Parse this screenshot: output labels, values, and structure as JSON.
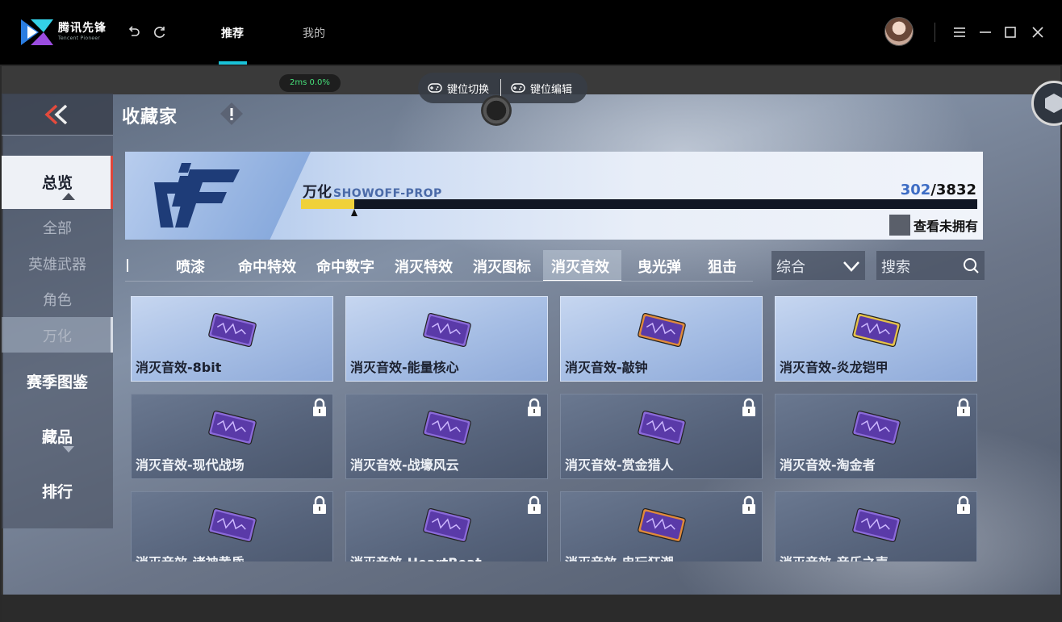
{
  "app": {
    "brand_cn": "腾讯先锋",
    "brand_en": "Tencent Pioneer",
    "tabs": [
      {
        "label": "推荐",
        "active": true
      },
      {
        "label": "我的",
        "active": false
      }
    ],
    "accent": "#19c2d8"
  },
  "overlay": {
    "ping": "2ms  0.0%",
    "key_switch": "键位切换",
    "key_edit": "键位编辑"
  },
  "page": {
    "title": "收藏家",
    "sidebar": [
      {
        "label": "总览",
        "type": "main",
        "active": true
      },
      {
        "label": "全部",
        "type": "sub",
        "active": false
      },
      {
        "label": "英雄武器",
        "type": "sub",
        "active": false
      },
      {
        "label": "角色",
        "type": "sub",
        "active": false
      },
      {
        "label": "万化",
        "type": "sub",
        "active": true
      },
      {
        "label": "赛季图鉴",
        "type": "main",
        "active": false
      },
      {
        "label": "藏品",
        "type": "main",
        "active": false
      },
      {
        "label": "排行",
        "type": "main",
        "active": false
      }
    ]
  },
  "banner": {
    "name": "万化",
    "subtitle": "SHOWOFF-PROP",
    "owned": 302,
    "total": 3832,
    "owned_text": "302",
    "total_text": "/3832",
    "unowned_label": "查看未拥有"
  },
  "categories": {
    "items": [
      "喷漆",
      "命中特效",
      "命中数字",
      "消灭特效",
      "消灭图标",
      "消灭音效",
      "曳光弹",
      "狙击"
    ],
    "active": "消灭音效",
    "sort_label": "综合",
    "search_placeholder": "搜索"
  },
  "items": [
    {
      "name": "消灭音效-8bit",
      "owned": true,
      "rarity": "purple"
    },
    {
      "name": "消灭音效-能量核心",
      "owned": true,
      "rarity": "purple"
    },
    {
      "name": "消灭音效-敲钟",
      "owned": true,
      "rarity": "orange"
    },
    {
      "name": "消灭音效-炎龙铠甲",
      "owned": true,
      "rarity": "gold"
    },
    {
      "name": "消灭音效-现代战场",
      "owned": false,
      "rarity": "purple"
    },
    {
      "name": "消灭音效-战壕风云",
      "owned": false,
      "rarity": "purple"
    },
    {
      "name": "消灭音效-赏金猎人",
      "owned": false,
      "rarity": "purple"
    },
    {
      "name": "消灭音效-淘金者",
      "owned": false,
      "rarity": "purple"
    },
    {
      "name": "消灭音效-诸神黄昏",
      "owned": false,
      "rarity": "purple"
    },
    {
      "name": "消灭音效-HeartBeat",
      "owned": false,
      "rarity": "purple"
    },
    {
      "name": "消灭音效-电玩狂潮",
      "owned": false,
      "rarity": "orange"
    },
    {
      "name": "消灭音效-音乐之声",
      "owned": false,
      "rarity": "purple"
    }
  ]
}
